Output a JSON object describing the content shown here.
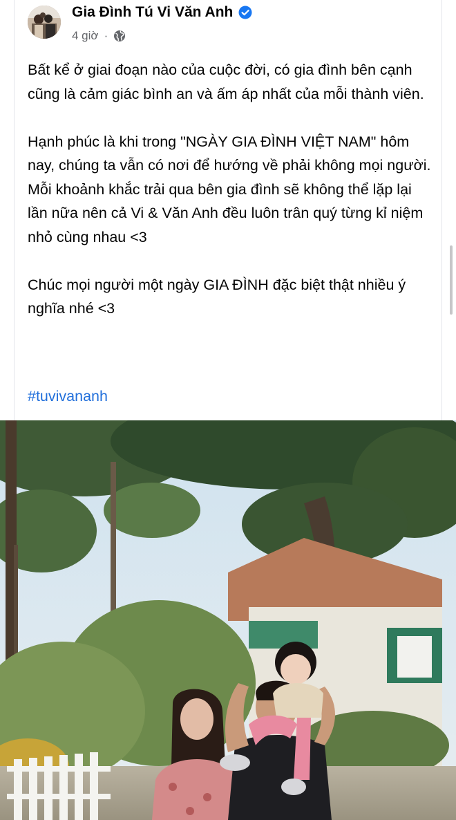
{
  "post": {
    "author": "Gia Đình Tú Vi Văn Anh",
    "time": "4 giờ",
    "separator": "·",
    "privacy_icon": "globe-icon",
    "paragraphs": [
      "Bất kể ở giai đoạn nào của cuộc đời, có gia đình bên cạnh cũng là cảm giác bình an và ấm áp nhất của mỗi thành viên.",
      "Hạnh phúc là khi trong \"NGÀY GIA ĐÌNH VIỆT NAM\" hôm nay, chúng ta vẫn có nơi để hướng về phải không mọi người. Mỗi khoảnh khắc trải qua bên gia đình sẽ không thể lặp lại lần nữa nên cả Vi & Văn Anh đều luôn trân quý từng kỉ niệm nhỏ cùng nhau <3",
      "Chúc mọi người một ngày GIA ĐÌNH đặc biệt thật nhiều ý nghĩa nhé <3"
    ],
    "hashtag": "#tuvivananh"
  },
  "colors": {
    "text": "#050505",
    "secondary": "#65676b",
    "link": "#216fdb",
    "verified": "#1877f2"
  }
}
